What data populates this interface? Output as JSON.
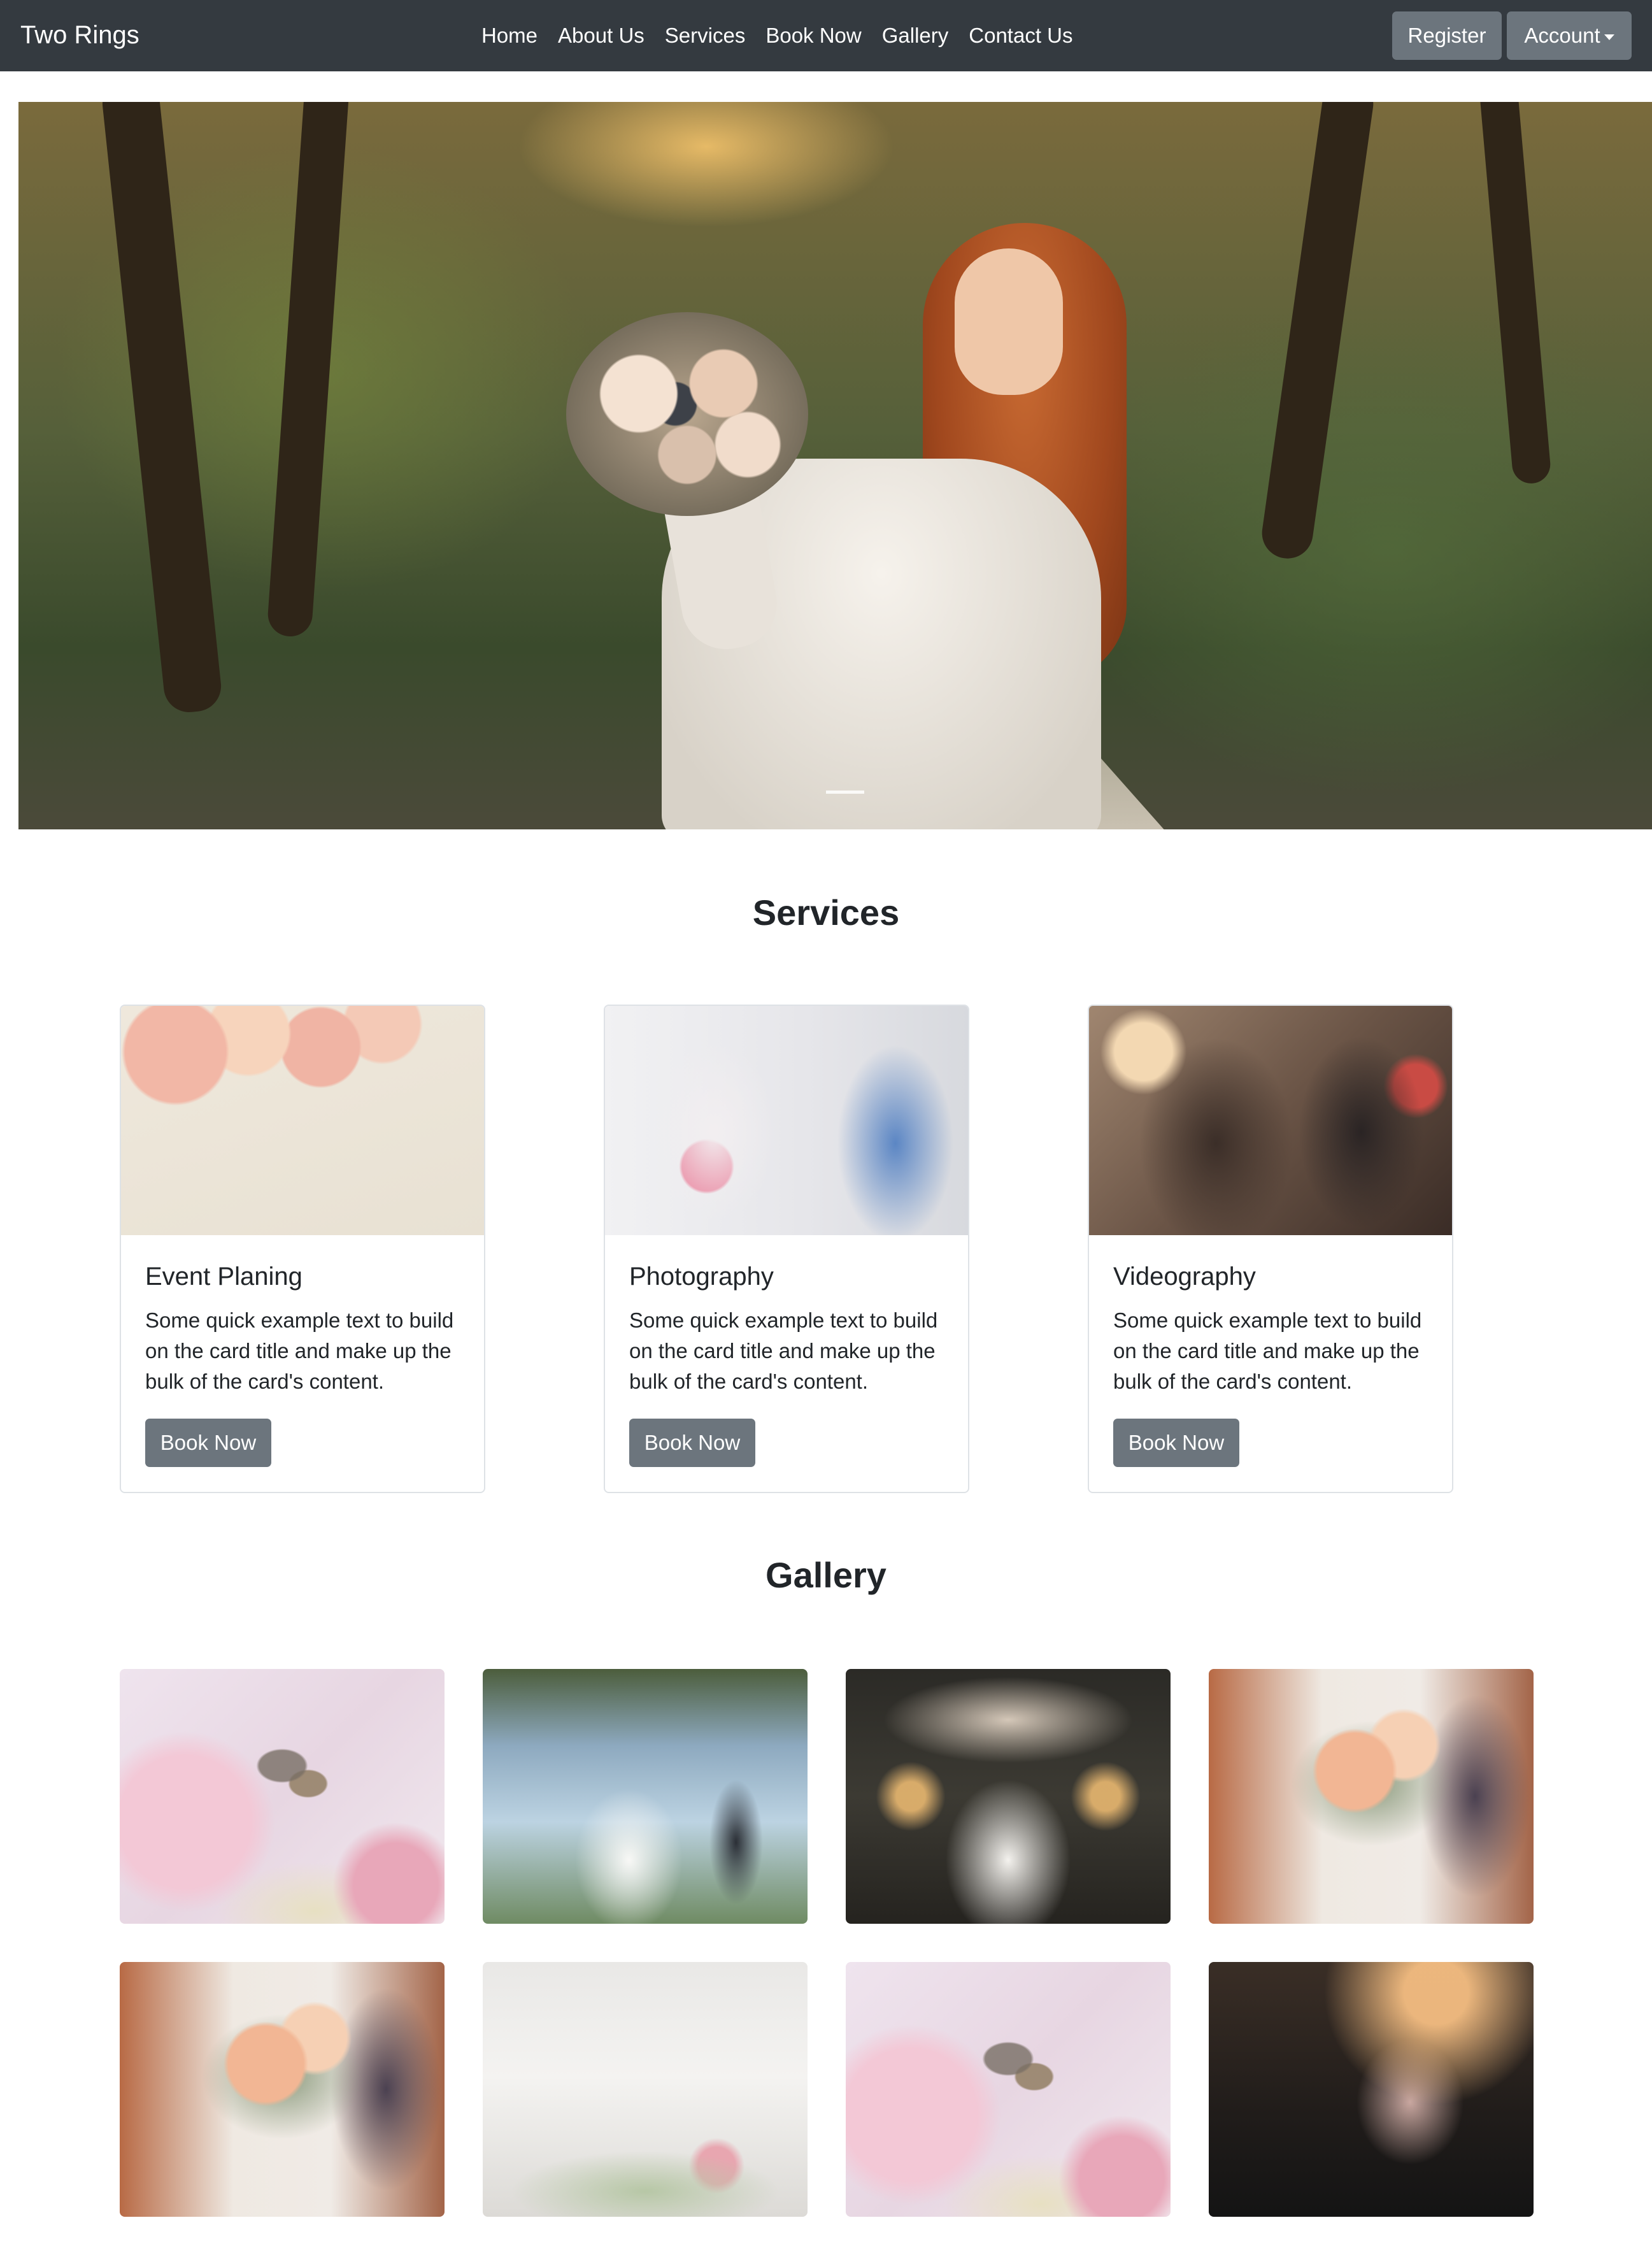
{
  "navbar": {
    "brand": "Two Rings",
    "links": [
      "Home",
      "About Us",
      "Services",
      "Book Now",
      "Gallery",
      "Contact Us"
    ],
    "register_label": "Register",
    "account_label": "Account"
  },
  "hero": {
    "image": "bride-in-forest-photo",
    "active_slide": 1
  },
  "services": {
    "title": "Services",
    "cards": [
      {
        "title": "Event Planing",
        "text": "Some quick example text to build on the card title and make up the bulk of the card's content.",
        "button": "Book Now",
        "image": "wedding-calendar-photo"
      },
      {
        "title": "Photography",
        "text": "Some quick example text to build on the card title and make up the bulk of the card's content.",
        "button": "Book Now",
        "image": "photographer-bride-photo"
      },
      {
        "title": "Videography",
        "text": "Some quick example text to build on the card title and make up the bulk of the card's content.",
        "button": "Book Now",
        "image": "videographer-photo"
      }
    ]
  },
  "gallery": {
    "title": "Gallery",
    "images": [
      "wedding-rings-photo",
      "couple-outdoor-photo",
      "couple-night-ceremony-photo",
      "bride-bouquet-photo",
      "bride-bouquet-photo",
      "reception-table-photo",
      "wedding-rings-photo",
      "bouquet-dark-photo"
    ]
  },
  "colors": {
    "navbar_bg": "#343a40",
    "button_bg": "#6c757d",
    "text": "#212529",
    "border": "#dee2e6"
  }
}
